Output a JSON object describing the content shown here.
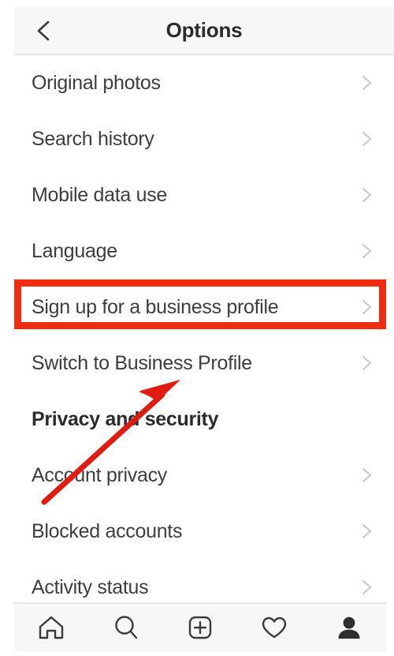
{
  "header": {
    "title": "Options",
    "back_icon": "chevron-left-icon"
  },
  "list": {
    "chevron_icon": "chevron-right-icon",
    "rows": [
      {
        "label": "Original photos",
        "type": "link",
        "chevron": true,
        "highlighted": false
      },
      {
        "label": "Search history",
        "type": "link",
        "chevron": true,
        "highlighted": false
      },
      {
        "label": "Mobile data use",
        "type": "link",
        "chevron": true,
        "highlighted": false
      },
      {
        "label": "Language",
        "type": "link",
        "chevron": true,
        "highlighted": false
      },
      {
        "label": "Sign up for a business profile",
        "type": "link",
        "chevron": true,
        "highlighted": false
      },
      {
        "label": "Switch to Business Profile",
        "type": "link",
        "chevron": true,
        "highlighted": true
      },
      {
        "label": "Privacy and security",
        "type": "heading",
        "chevron": false,
        "highlighted": false
      },
      {
        "label": "Account privacy",
        "type": "link",
        "chevron": true,
        "highlighted": false
      },
      {
        "label": "Blocked accounts",
        "type": "link",
        "chevron": true,
        "highlighted": false
      },
      {
        "label": "Activity status",
        "type": "link",
        "chevron": true,
        "highlighted": false
      }
    ]
  },
  "annotation": {
    "highlight_color": "#f02d10",
    "arrow_color": "#e01b0f",
    "target_label": "Switch to Business Profile"
  },
  "bottom_nav": {
    "items": [
      {
        "icon": "home-icon",
        "label": "Home"
      },
      {
        "icon": "search-icon",
        "label": "Search"
      },
      {
        "icon": "add-post-icon",
        "label": "New post"
      },
      {
        "icon": "heart-icon",
        "label": "Activity"
      },
      {
        "icon": "profile-icon",
        "label": "Profile"
      }
    ]
  },
  "colors": {
    "header_bg": "#f7f7f7",
    "text": "#3d3d3d",
    "heading_text": "#2b2b2b",
    "chevron": "#c8c8c8",
    "nav_bg": "#f7f7f7",
    "nav_icon": "#3a3a3a"
  }
}
